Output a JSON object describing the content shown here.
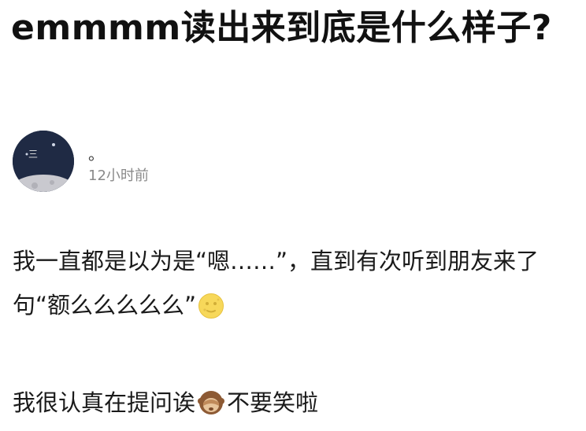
{
  "post": {
    "title": "emmmm读出来到底是什么样子?"
  },
  "author": {
    "name": "。",
    "time": "12小时前",
    "avatar_colors": {
      "sky": "#1f2a44",
      "moon": "#c9c9cf",
      "text": "#e8e8e8"
    }
  },
  "content": {
    "para1": "我一直都是以为是“嗯……”，直到有次听到朋友来了句“额么么么么么”",
    "para1_emoji": "moon-face-icon",
    "para2_before": "我很认真在提问诶",
    "para2_emoji": "see-no-evil-monkey-icon",
    "para2_after": "不要笑啦"
  },
  "colors": {
    "text": "#1a1a1a",
    "muted": "#8a8a8a",
    "moon_yellow": "#f7d85a",
    "monkey_brown": "#8d5a34"
  }
}
